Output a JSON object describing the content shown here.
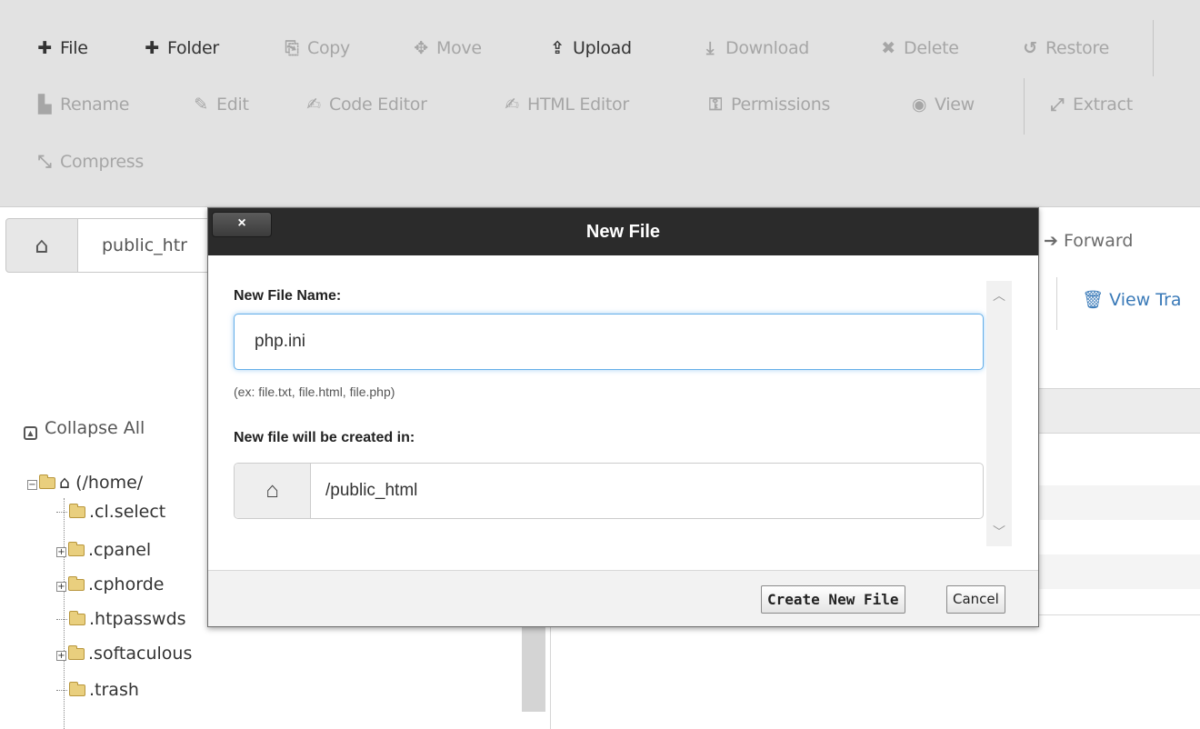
{
  "toolbar": {
    "row1": [
      {
        "label": "File",
        "icon": "plus-icon",
        "glyph": "✚",
        "enabled": true
      },
      {
        "label": "Folder",
        "icon": "plus-icon",
        "glyph": "✚",
        "enabled": true
      },
      {
        "label": "Copy",
        "icon": "copy-icon",
        "glyph": "⎘",
        "enabled": false
      },
      {
        "label": "Move",
        "icon": "move-icon",
        "glyph": "✥",
        "enabled": false
      },
      {
        "label": "Upload",
        "icon": "upload-icon",
        "glyph": "⇪",
        "enabled": true
      },
      {
        "label": "Download",
        "icon": "download-icon",
        "glyph": "⤓",
        "enabled": false
      },
      {
        "label": "Delete",
        "icon": "delete-icon",
        "glyph": "✖",
        "enabled": false
      },
      {
        "label": "Restore",
        "icon": "restore-icon",
        "glyph": "↺",
        "enabled": false
      }
    ],
    "row2": [
      {
        "label": "Rename",
        "icon": "rename-icon",
        "glyph": "▙",
        "enabled": false
      },
      {
        "label": "Edit",
        "icon": "pencil-icon",
        "glyph": "✎",
        "enabled": false
      },
      {
        "label": "Code Editor",
        "icon": "code-editor-icon",
        "glyph": "✍",
        "enabled": false
      },
      {
        "label": "HTML Editor",
        "icon": "html-editor-icon",
        "glyph": "✍",
        "enabled": false
      },
      {
        "label": "Permissions",
        "icon": "key-icon",
        "glyph": "⚿",
        "enabled": false
      },
      {
        "label": "View",
        "icon": "eye-icon",
        "glyph": "◉",
        "enabled": false
      },
      {
        "label": "Extract",
        "icon": "extract-icon",
        "glyph": "⤢",
        "enabled": false
      }
    ],
    "row3": [
      {
        "label": "Compress",
        "icon": "compress-icon",
        "glyph": "⤡",
        "enabled": false
      }
    ]
  },
  "nav": {
    "path_value": "public_htr",
    "forward_label": "Forward",
    "trash_label": "View Tra"
  },
  "tree": {
    "collapse_label": "Collapse All",
    "root_label": "(/home/",
    "items": [
      {
        "label": ".cl.select",
        "expandable": false
      },
      {
        "label": ".cpanel",
        "expandable": true
      },
      {
        "label": ".cphorde",
        "expandable": true
      },
      {
        "label": ".htpasswds",
        "expandable": false
      },
      {
        "label": ".softaculous",
        "expandable": true
      },
      {
        "label": ".trash",
        "expandable": false
      }
    ]
  },
  "modal": {
    "title": "New File",
    "close_label": "×",
    "name_label": "New File Name:",
    "name_value": "php.ini",
    "hint": "(ex: file.txt, file.html, file.php)",
    "location_label": "New file will be created in:",
    "location_value": "/public_html",
    "create_label": "Create New File",
    "cancel_label": "Cancel"
  },
  "colors": {
    "toolbar_bg": "#e2e2e2",
    "modal_header": "#2b2b2b",
    "focus_ring": "#66afe9",
    "link": "#3a7ab8"
  }
}
